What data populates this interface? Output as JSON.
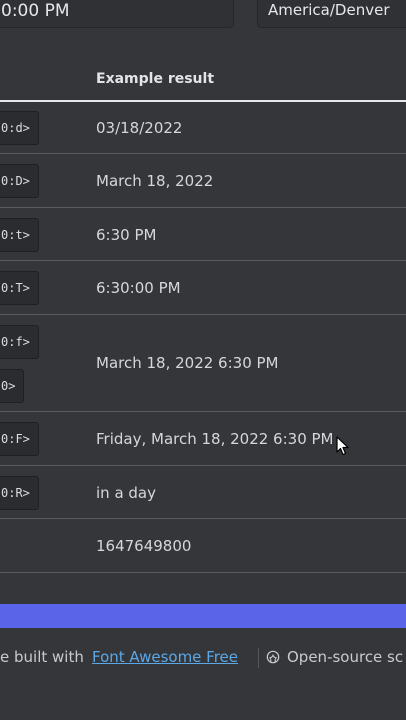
{
  "inputs": {
    "time_value": "0:00 PM",
    "timezone_value": "America/Denver"
  },
  "table": {
    "header_result": "Example result",
    "rows": [
      {
        "code": "0:d>",
        "result": "03/18/2022"
      },
      {
        "code": "0:D>",
        "result": "March 18, 2022"
      },
      {
        "code": "0:t>",
        "result": "6:30 PM"
      },
      {
        "code": "0:T>",
        "result": "6:30:00 PM"
      },
      {
        "code": "0:f>",
        "code2": "0>",
        "result": "March 18, 2022 6:30 PM"
      },
      {
        "code": "0:F>",
        "result": "Friday, March 18, 2022 6:30 PM"
      },
      {
        "code": "0:R>",
        "result": "in a day"
      },
      {
        "code": "",
        "result": "1647649800"
      }
    ]
  },
  "footer": {
    "text_before": "e built with",
    "link": "Font Awesome Free",
    "text_after": "Open-source sc",
    "icon": "github-icon"
  },
  "colors": {
    "background": "#35363a",
    "accent_bar": "#5964e8",
    "link": "#5aa8e8"
  }
}
